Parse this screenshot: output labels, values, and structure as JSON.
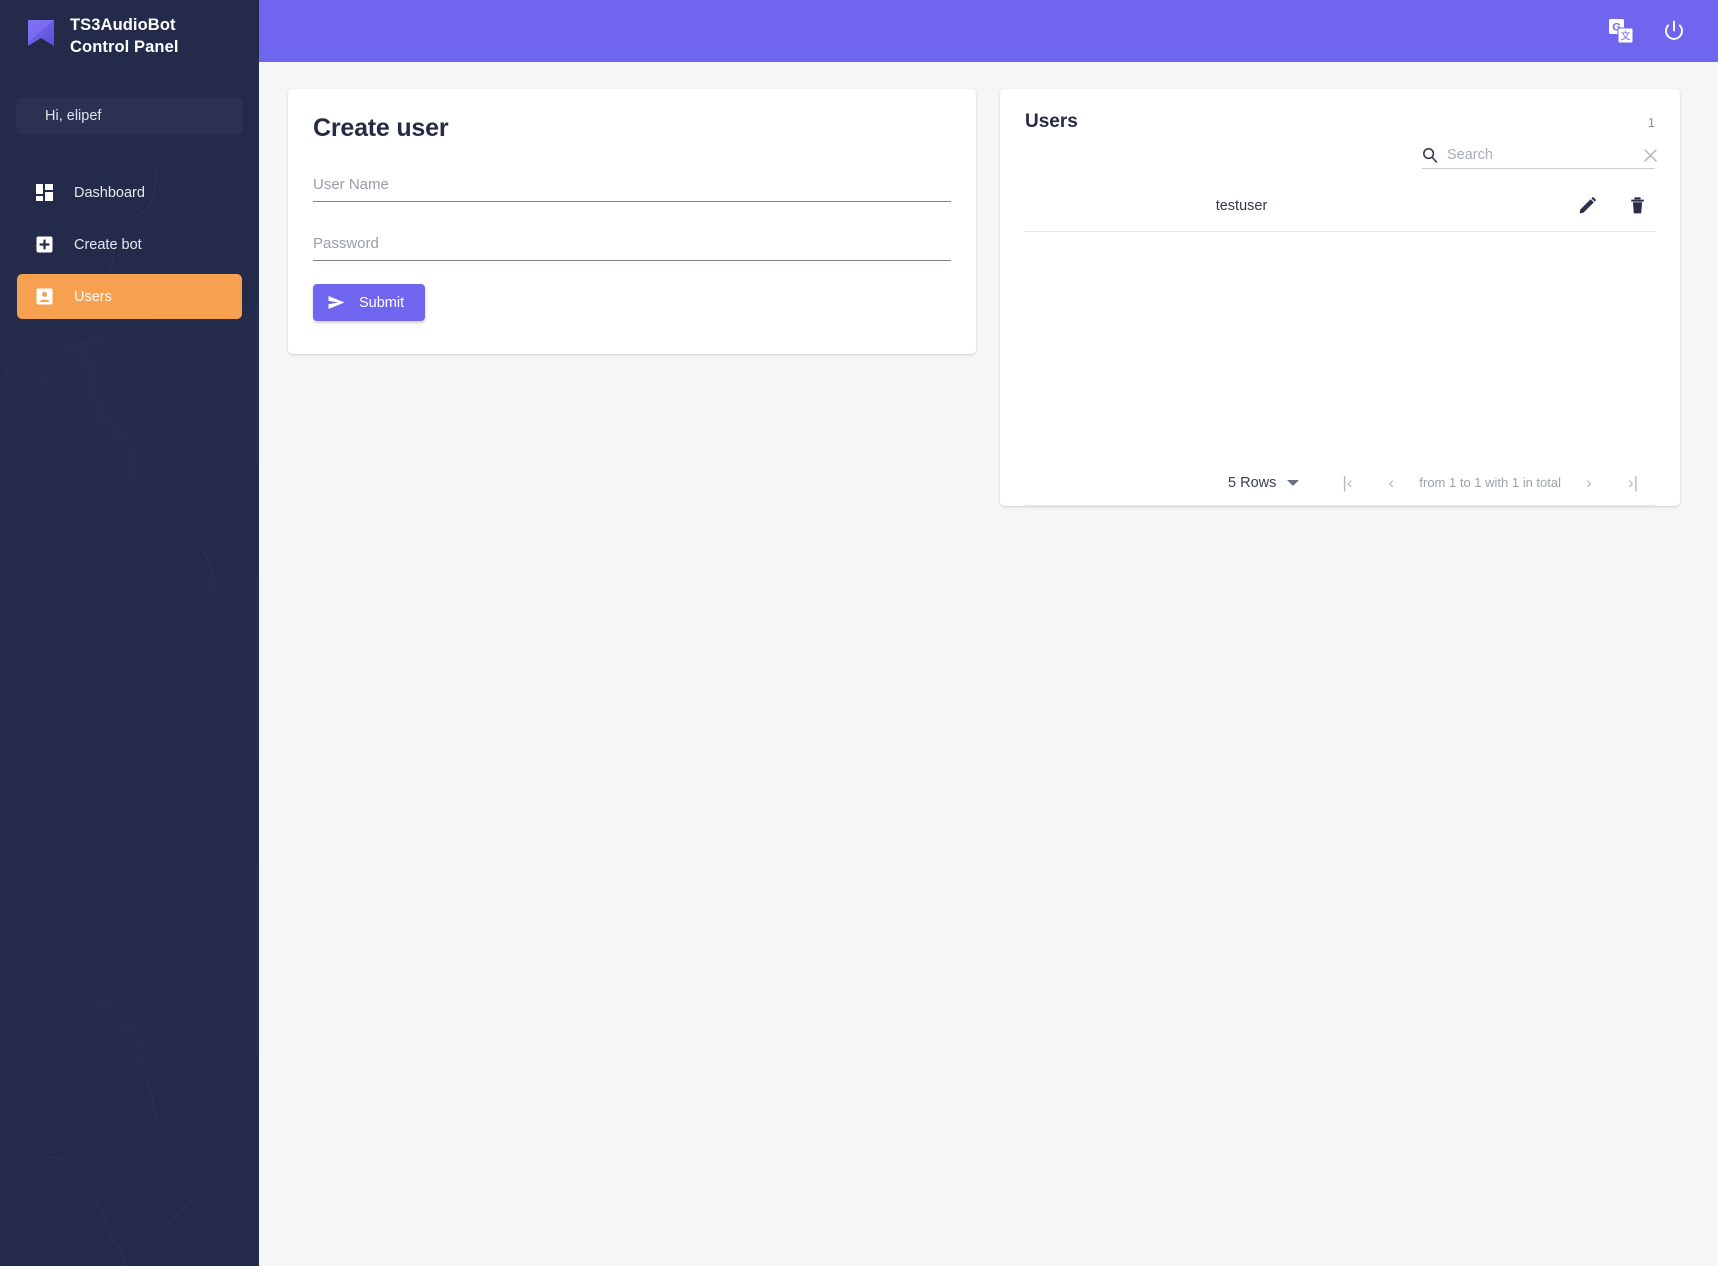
{
  "sidebar": {
    "brand": {
      "logo_icon": "bookmark-logo-icon",
      "line1": "TS3AudioBot",
      "line2": "Control Panel"
    },
    "greeting": "Hi, elipef",
    "items": [
      {
        "label": "Dashboard",
        "icon": "dashboard-grid-icon",
        "active": false
      },
      {
        "label": "Create bot",
        "icon": "plus-square-icon",
        "active": false
      },
      {
        "label": "Users",
        "icon": "contact-card-icon",
        "active": true
      }
    ],
    "background_color": "#242a4a",
    "active_color": "#f6a050"
  },
  "topbar": {
    "background_color": "#7065ee",
    "icons": [
      {
        "name": "google-translate-icon"
      },
      {
        "name": "power-icon"
      }
    ]
  },
  "create_user_card": {
    "title": "Create user",
    "username": {
      "placeholder": "User Name",
      "value": ""
    },
    "password": {
      "placeholder": "Password",
      "value": ""
    },
    "submit_label": "Submit",
    "submit_icon": "send-icon",
    "submit_color": "#7065ee"
  },
  "users_card": {
    "title": "Users",
    "count": "1",
    "search": {
      "placeholder": "Search",
      "value": "",
      "icon": "search-icon",
      "clear_icon": "close-icon"
    },
    "rows": [
      {
        "name": "testuser",
        "edit_icon": "pencil-icon",
        "delete_icon": "trash-icon"
      }
    ],
    "pagination": {
      "rows_per_page": "5 Rows",
      "first_label": "|‹",
      "prev_label": "‹",
      "range_label": "from 1 to 1 with 1 in total",
      "next_label": "›",
      "last_label": "›|"
    }
  }
}
